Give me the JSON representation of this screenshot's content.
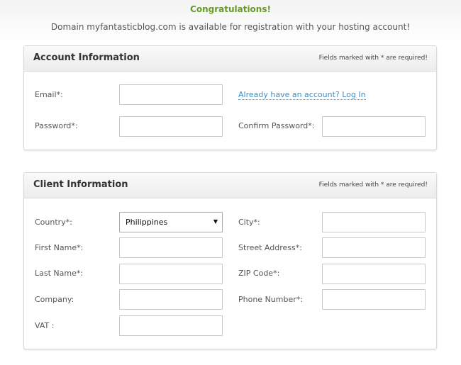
{
  "header": {
    "congrats": "Congratulations!",
    "subtitle": "Domain myfantasticblog.com is available for registration with your hosting account!"
  },
  "account": {
    "title": "Account Information",
    "required_note": "Fields marked with * are required!",
    "email_label": "Email*:",
    "login_link": "Already have an account? Log In",
    "password_label": "Password*:",
    "confirm_label": "Confirm Password*:"
  },
  "client": {
    "title": "Client Information",
    "required_note": "Fields marked with * are required!",
    "country_label": "Country*:",
    "country_value": "Philippines",
    "city_label": "City*:",
    "first_name_label": "First Name*:",
    "street_label": "Street Address*:",
    "last_name_label": "Last Name*:",
    "zip_label": "ZIP Code*:",
    "company_label": "Company:",
    "phone_label": "Phone Number*:",
    "vat_label": "VAT :"
  },
  "colors": {
    "accent_green": "#6a9a26",
    "link_blue": "#3b8fc9"
  }
}
